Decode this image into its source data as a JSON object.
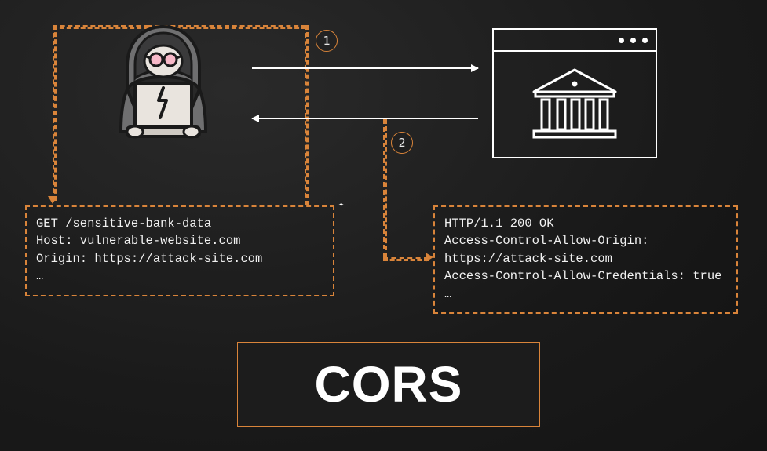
{
  "steps": {
    "one": "1",
    "two": "2"
  },
  "request": {
    "line1": "GET /sensitive-bank-data",
    "line2": "Host: vulnerable-website.com",
    "line3": "Origin: https://attack-site.com",
    "line4": "…"
  },
  "response": {
    "line1": "HTTP/1.1 200 OK",
    "line2": "Access-Control-Allow-Origin:",
    "line3": "https://attack-site.com",
    "line4": "Access-Control-Allow-Credentials: true",
    "line5": "…"
  },
  "title": "CORS",
  "icons": {
    "hacker": "hacker-with-laptop",
    "bank": "bank-building",
    "marker": "✦"
  },
  "colors": {
    "accent": "#d9843a",
    "bg": "#1a1a1a",
    "text": "#e5e5e5"
  }
}
